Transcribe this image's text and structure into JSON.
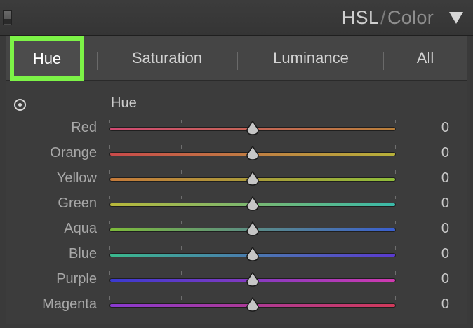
{
  "header": {
    "title_main": "HSL",
    "title_sep": "/",
    "title_alt": "Color"
  },
  "tabs": [
    {
      "label": "Hue",
      "active": true
    },
    {
      "label": "Saturation",
      "active": false
    },
    {
      "label": "Luminance",
      "active": false
    },
    {
      "label": "All",
      "active": false
    }
  ],
  "section": {
    "label": "Hue"
  },
  "sliders": [
    {
      "label": "Red",
      "value": 0,
      "fraction": 0.5,
      "gradient": [
        "#d14a72",
        "#b9803a"
      ]
    },
    {
      "label": "Orange",
      "value": 0,
      "fraction": 0.5,
      "gradient": [
        "#c94a4a",
        "#b7b13a"
      ]
    },
    {
      "label": "Yellow",
      "value": 0,
      "fraction": 0.5,
      "gradient": [
        "#c57a3a",
        "#8fbd3a"
      ]
    },
    {
      "label": "Green",
      "value": 0,
      "fraction": 0.5,
      "gradient": [
        "#b9b83a",
        "#3ab9a9"
      ]
    },
    {
      "label": "Aqua",
      "value": 0,
      "fraction": 0.5,
      "gradient": [
        "#7dbb3a",
        "#3a5fd0"
      ]
    },
    {
      "label": "Blue",
      "value": 0,
      "fraction": 0.5,
      "gradient": [
        "#3ab98d",
        "#5a3ad0"
      ]
    },
    {
      "label": "Purple",
      "value": 0,
      "fraction": 0.5,
      "gradient": [
        "#3a3ad0",
        "#d03ab0"
      ]
    },
    {
      "label": "Magenta",
      "value": 0,
      "fraction": 0.5,
      "gradient": [
        "#8a3ad0",
        "#d03a5a"
      ]
    }
  ]
}
